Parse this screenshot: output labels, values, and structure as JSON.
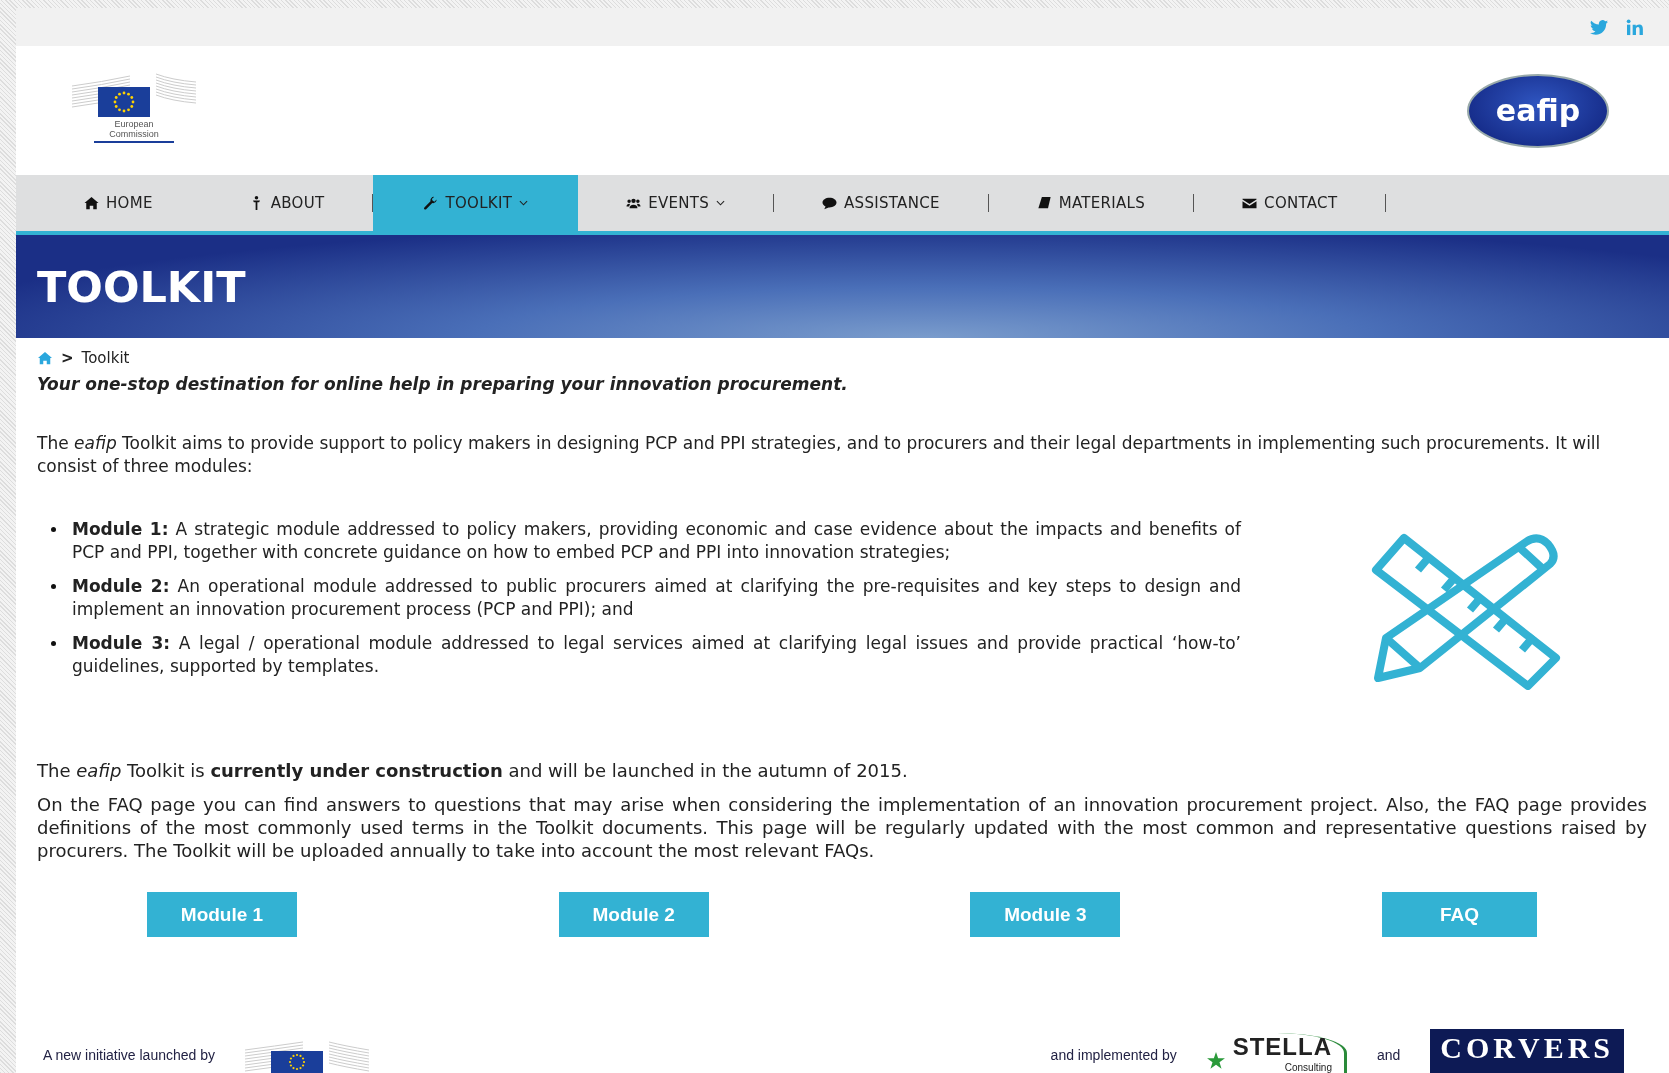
{
  "header": {
    "ec_logo_text": "European Commission",
    "eafip_logo_text": "eafip"
  },
  "nav": [
    {
      "label": "HOME",
      "selected": false,
      "dropdown": false
    },
    {
      "label": "ABOUT",
      "selected": false,
      "dropdown": false
    },
    {
      "label": "TOOLKIT",
      "selected": true,
      "dropdown": true
    },
    {
      "label": "EVENTS",
      "selected": false,
      "dropdown": true
    },
    {
      "label": "ASSISTANCE",
      "selected": false,
      "dropdown": false
    },
    {
      "label": "MATERIALS",
      "selected": false,
      "dropdown": false
    },
    {
      "label": "CONTACT",
      "selected": false,
      "dropdown": false
    }
  ],
  "banner": {
    "title": "TOOLKIT"
  },
  "breadcrumb": {
    "separator": ">",
    "current": "Toolkit"
  },
  "tagline": "Your one-stop destination for online help in preparing your innovation procurement.",
  "intro": "The *eafip* Toolkit aims to provide support to policy makers in designing PCP and PPI strategies, and to procurers and their legal departments in implementing such procurements. It will consist of three modules:",
  "modules": [
    {
      "name": "Module 1:",
      "text": "A strategic module addressed to policy makers, providing economic and case evidence about the impacts and benefits of PCP and PPI, together with concrete guidance on how to embed PCP and PPI into innovation strategies;"
    },
    {
      "name": "Module 2:",
      "text": "An operational module addressed to public procurers aimed at clarifying the pre-requisites and key steps to design and implement an innovation procurement process (PCP and PPI); and"
    },
    {
      "name": "Module 3:",
      "text": "A legal / operational module addressed to legal services aimed at clarifying legal issues and provide practical ‘how-to’ guidelines, supported by templates."
    }
  ],
  "status_note": "The *eafip* Toolkit is **currently under construction** and will be launched in the autumn of 2015.",
  "faq_note": "On the FAQ page you can find answers to questions that may arise when considering the implementation of an innovation procurement project. Also, the FAQ page provides definitions of the most commonly used terms in the Toolkit documents. This page will be regularly updated with the most common and representative questions raised by procurers. The Toolkit will be uploaded annually to take into account the most relevant FAQs.",
  "buttons": [
    "Module 1",
    "Module 2",
    "Module 3",
    "FAQ"
  ],
  "footer": {
    "launched_by": "A new initiative launched by",
    "implemented_by": "and implemented by",
    "stella": "STELLA",
    "stella_sub": "Consulting",
    "and": "and",
    "corvers": "CORVERS"
  }
}
